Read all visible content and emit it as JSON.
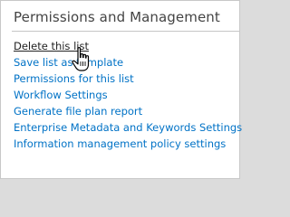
{
  "panel": {
    "title": "Permissions and Management",
    "items": [
      {
        "label": "Delete this list",
        "state": "hovered"
      },
      {
        "label": "Save list as template"
      },
      {
        "label": "Permissions for this list"
      },
      {
        "label": "Workflow Settings"
      },
      {
        "label": "Generate file plan report"
      },
      {
        "label": "Enterprise Metadata and Keywords Settings"
      },
      {
        "label": "Information management policy settings"
      }
    ]
  },
  "cursor": {
    "icon": "hand-pointer-icon"
  },
  "colors": {
    "link": "#0072c6",
    "hovered_link": "#222222",
    "heading": "#444444"
  }
}
